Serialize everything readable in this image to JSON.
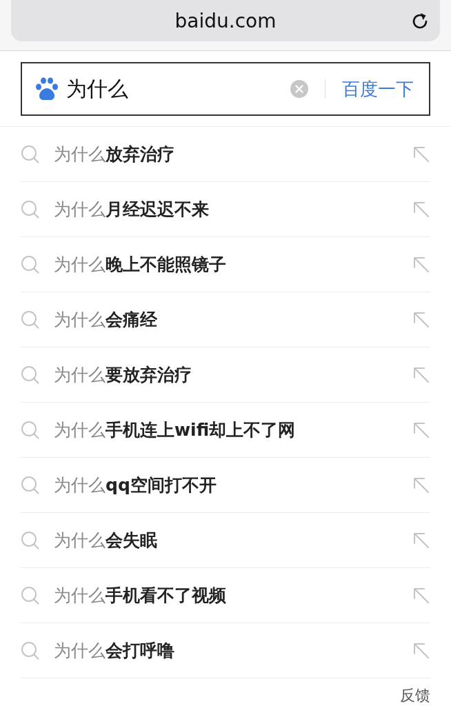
{
  "address_bar": {
    "url": "baidu.com"
  },
  "search": {
    "value": "为什么",
    "button": "百度一下"
  },
  "suggestions": [
    {
      "prefix": "为什么",
      "completion": "放弃治疗"
    },
    {
      "prefix": "为什么",
      "completion": "月经迟迟不来"
    },
    {
      "prefix": "为什么",
      "completion": "晚上不能照镜子"
    },
    {
      "prefix": "为什么",
      "completion": "会痛经"
    },
    {
      "prefix": "为什么",
      "completion": "要放弃治疗"
    },
    {
      "prefix": "为什么",
      "completion": "手机连上wifi却上不了网"
    },
    {
      "prefix": "为什么",
      "completion": "qq空间打不开"
    },
    {
      "prefix": "为什么",
      "completion": "会失眠"
    },
    {
      "prefix": "为什么",
      "completion": "手机看不了视频"
    },
    {
      "prefix": "为什么",
      "completion": "会打呼噜"
    }
  ],
  "feedback": "反馈"
}
